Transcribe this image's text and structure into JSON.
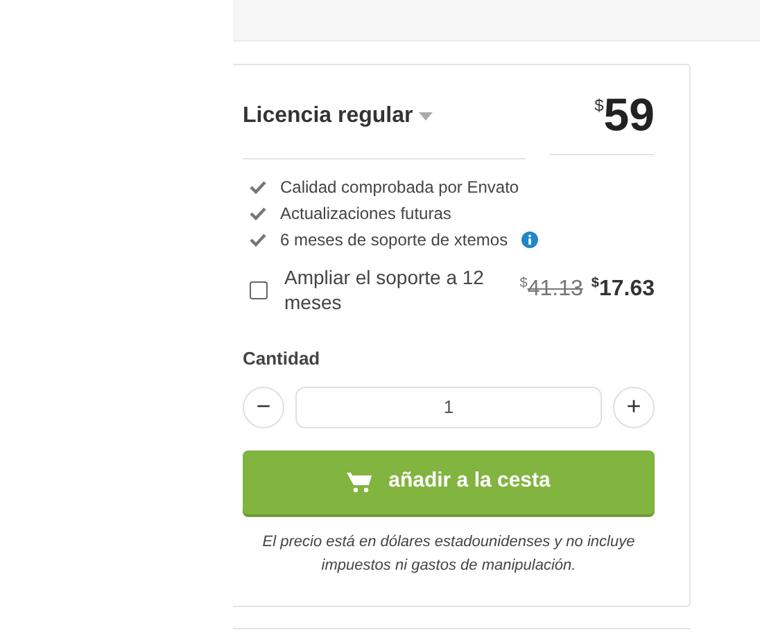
{
  "license": {
    "label": "Licencia regular",
    "currency": "$",
    "price": "59"
  },
  "features": [
    {
      "text": "Calidad comprobada por Envato",
      "info": false
    },
    {
      "text": "Actualizaciones futuras",
      "info": false
    },
    {
      "text": "6 meses de soporte de xtemos",
      "info": true
    }
  ],
  "extend_support": {
    "label": "Ampliar el soporte a 12 meses",
    "checked": false,
    "old_currency": "$",
    "old_price": "41.13",
    "currency": "$",
    "price": "17.63"
  },
  "quantity": {
    "label": "Cantidad",
    "minus": "−",
    "value": "1",
    "plus": "+"
  },
  "add_to_cart": "añadir a la cesta",
  "note": "El precio está en dólares estadounidenses y no incluye impuestos ni gastos de manipulación."
}
